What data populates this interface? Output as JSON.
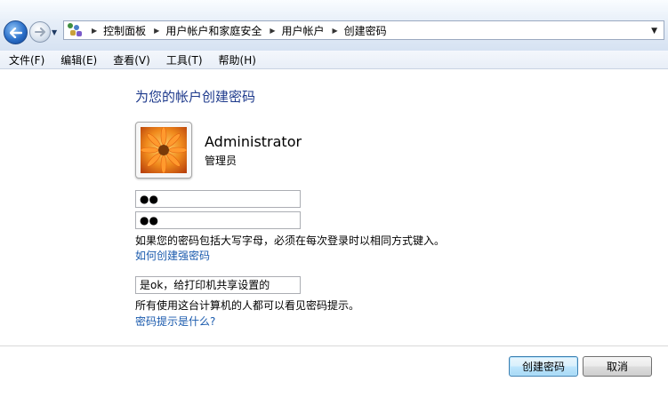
{
  "address_bar": {
    "breadcrumbs": [
      "控制面板",
      "用户帐户和家庭安全",
      "用户帐户",
      "创建密码"
    ]
  },
  "menu": [
    "文件(F)",
    "编辑(E)",
    "查看(V)",
    "工具(T)",
    "帮助(H)"
  ],
  "page_title": "为您的帐户创建密码",
  "user": {
    "name": "Administrator",
    "role": "管理员"
  },
  "password_field_value": "●●",
  "confirm_password_field_value": "●●",
  "caps_note": "如果您的密码包括大写字母，必须在每次登录时以相同方式键入。",
  "strong_password_link": "如何创建强密码",
  "hint_field_value": "是ok，给打印机共享设置的",
  "hint_note": "所有使用这台计算机的人都可以看见密码提示。",
  "hint_help_link": "密码提示是什么?",
  "buttons": {
    "create": "创建密码",
    "cancel": "取消"
  },
  "icons": {
    "back": "back-arrow-icon",
    "forward": "forward-arrow-icon",
    "address": "control-panel-users-icon",
    "user_picture": "flower-user-picture"
  }
}
